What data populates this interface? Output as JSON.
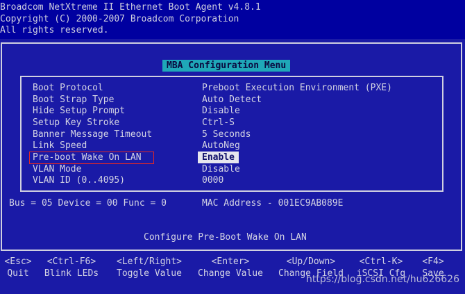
{
  "header": {
    "line1": "Broadcom NetXtreme II Ethernet Boot Agent v4.8.1",
    "line2": "Copyright (C) 2000-2007 Broadcom Corporation",
    "line3": "All rights reserved."
  },
  "menu": {
    "title": "MBA Configuration Menu",
    "items": [
      {
        "label": "Boot Protocol",
        "value": "Preboot Execution Environment (PXE)"
      },
      {
        "label": "Boot Strap Type",
        "value": "Auto Detect"
      },
      {
        "label": "Hide Setup Prompt",
        "value": "Disable"
      },
      {
        "label": "Setup Key Stroke",
        "value": "Ctrl-S"
      },
      {
        "label": "Banner Message Timeout",
        "value": "5 Seconds"
      },
      {
        "label": "Link Speed",
        "value": "AutoNeg"
      },
      {
        "label": "Pre-boot Wake On LAN",
        "value": "Enable"
      },
      {
        "label": "VLAN Mode",
        "value": "Disable"
      },
      {
        "label": "VLAN ID (0..4095)",
        "value": "0000"
      }
    ]
  },
  "info": {
    "bus": "Bus = 05 Device = 00 Func = 0",
    "mac": "MAC Address - 001EC9AB089E"
  },
  "status": "Configure Pre-Boot Wake On LAN",
  "footer": {
    "keys": [
      {
        "key": "<Esc>",
        "action": "Quit"
      },
      {
        "key": "<Ctrl-F6>",
        "action": "Blink LEDs"
      },
      {
        "key": "<Left/Right>",
        "action": "Toggle Value"
      },
      {
        "key": "<Enter>",
        "action": "Change Value"
      },
      {
        "key": "<Up/Down>",
        "action": "Change Field"
      },
      {
        "key": "<Ctrl-K>",
        "action": "iSCSI Cfg"
      },
      {
        "key": "<F4>",
        "action": "Save"
      }
    ]
  },
  "watermark": "https://blog.csdn.net/hu626626"
}
